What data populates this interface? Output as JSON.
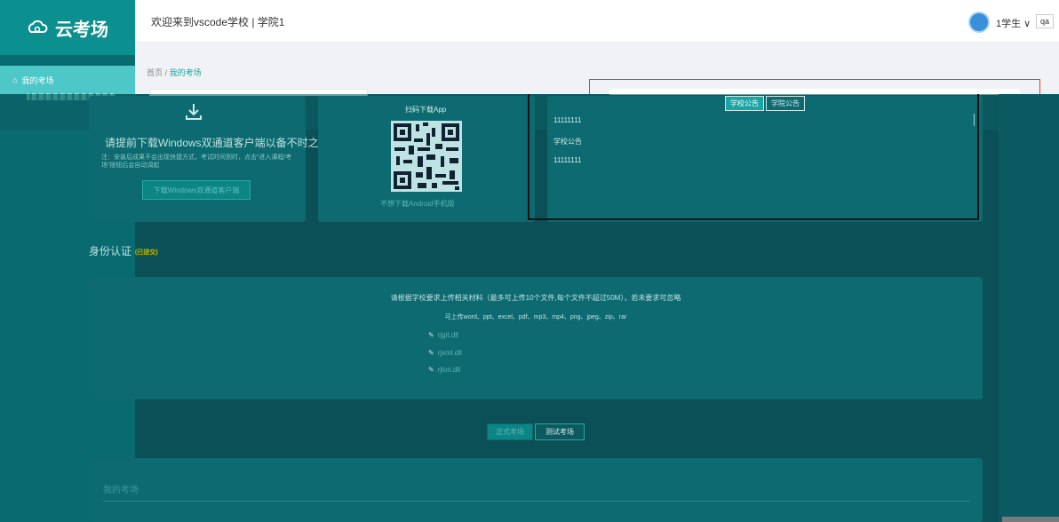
{
  "app": {
    "logo_text": "云考场"
  },
  "header": {
    "welcome": "欢迎来到vscode学校 | 学院1",
    "user": "1学生 ∨",
    "lang": "qa"
  },
  "sidebar": {
    "items": [
      {
        "label": "我的考场"
      }
    ]
  },
  "breadcrumb": {
    "home": "首页",
    "sep": "/",
    "current": "我的考场"
  },
  "download_card": {
    "title": "请提前下载Windows双通道客户端以备不时之需",
    "note": "注：安装后成果不会出现快捷方式，考试时间到时，点击“进入课程/考场”按钮后会自动调起",
    "button": "下载Windows双通道客户端"
  },
  "qr_card": {
    "title": "扫码下载App",
    "caption": "不想下载Android手机版"
  },
  "notice": {
    "tabs": [
      "学校公告",
      "学院公告"
    ],
    "lines": [
      "11111111",
      "学校公告",
      "11111111"
    ]
  },
  "identity": {
    "title": "身份认证",
    "badge": "(已提交)",
    "instruction": "请根据学校要求上传相关材料（最多可上传10个文件,每个文件不超过50M），若未要求可忽略",
    "types": "可上传word、ppt、excel、pdf、mp3、mp4、png、jpeg、zip、rar",
    "files": [
      "rjgit.dll",
      "rjxml.dll",
      "rjlon.dll"
    ]
  },
  "exam_tabs": {
    "formal": "正式考场",
    "test": "测试考场"
  },
  "my_exams": {
    "title": "我的考场"
  },
  "colors": {
    "brand": "#0c8f8f",
    "accent": "#19a5a5",
    "overlay": "#0b5057"
  }
}
